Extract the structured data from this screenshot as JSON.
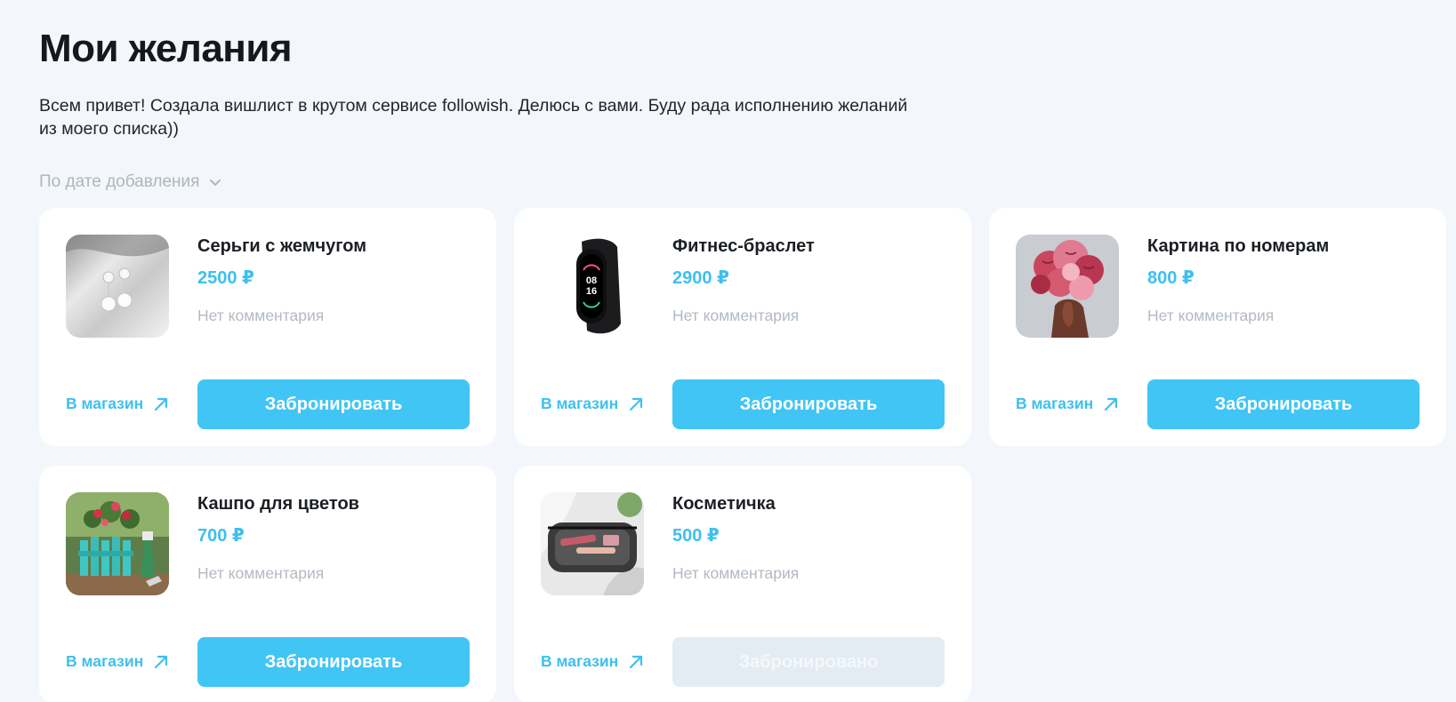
{
  "page": {
    "title": "Мои желания",
    "description": "Всем привет! Создала вишлист в крутом сервисе followish. Делюсь с вами. Буду рада исполнению желаний из моего списка))",
    "sort_label": "По дате добавления",
    "sort_icon": "chevron-down-icon"
  },
  "colors": {
    "accent": "#41c5f4",
    "price": "#3ec0ef",
    "muted": "#b3bac3",
    "background": "#f3f6fb",
    "booked_bg": "#e3ecf3"
  },
  "items": [
    {
      "name": "Серьги с жемчугом",
      "price": "2500 ₽",
      "comment": "Нет комментария",
      "shop_label": "В магазин",
      "button_label": "Забронировать",
      "booked": false,
      "image": "pearl-earrings"
    },
    {
      "name": "Фитнес-браслет",
      "price": "2900 ₽",
      "comment": "Нет комментария",
      "shop_label": "В магазин",
      "button_label": "Забронировать",
      "booked": false,
      "image": "fitness-band",
      "band_time_top": "08",
      "band_time_bottom": "16"
    },
    {
      "name": "Картина по номерам",
      "price": "800 ₽",
      "comment": "Нет комментария",
      "shop_label": "В магазин",
      "button_label": "Забронировать",
      "booked": false,
      "image": "flower-painting"
    },
    {
      "name": "Кашпо для цветов",
      "price": "700 ₽",
      "comment": "Нет комментария",
      "shop_label": "В магазин",
      "button_label": "Забронировать",
      "booked": false,
      "image": "flower-planter"
    },
    {
      "name": "Косметичка",
      "price": "500 ₽",
      "comment": "Нет комментария",
      "shop_label": "В магазин",
      "button_label": "Забронировано",
      "booked": true,
      "image": "cosmetic-bag"
    }
  ]
}
